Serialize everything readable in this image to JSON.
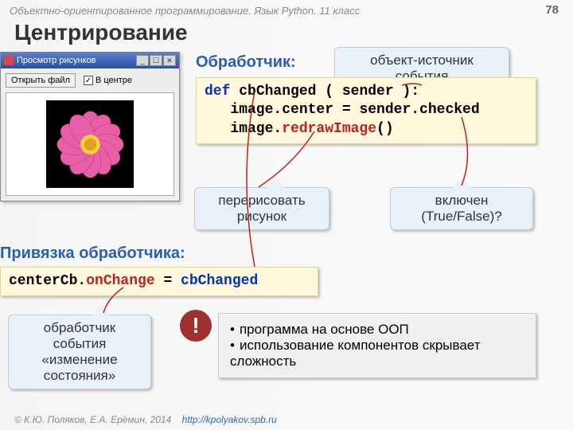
{
  "header": "Объектно-ориентированное программирование. Язык Python. 11 класс",
  "page_num": "78",
  "title": "Центрирование",
  "window": {
    "title": "Просмотр рисунков",
    "open_btn": "Открыть файл",
    "checkbox_label": "В центре",
    "checkbox_checked": "✓",
    "min": "_",
    "max": "☐",
    "close": "✕"
  },
  "handler_label": "Обработчик:",
  "code1": {
    "l1a": "def ",
    "l1b": "cbChanged",
    "l1c": " ( sender ):",
    "l2a": "   image.center",
    "l2b": " = ",
    "l2c": "sender.checked",
    "l3a": "   image.",
    "l3b": "redrawImage",
    "l3c": "()"
  },
  "callout_source": "объект-источник события",
  "callout_redraw": "перерисовать рисунок",
  "callout_checked": "включен (True/False)?",
  "bind_label": "Привязка обработчика:",
  "code2": {
    "a": "centerCb.",
    "b": "onChange",
    "c": " = ",
    "d": "cbChanged"
  },
  "callout_handler": "обработчик события «изменение состояния»",
  "oop": {
    "item1": "программа на основе ООП",
    "item2": "использование компонентов скрывает сложность"
  },
  "excl": "!",
  "footer": {
    "authors": "© К.Ю. Поляков, Е.А. Ерёмин, 2014",
    "url": "http://kpolyakov.spb.ru"
  }
}
